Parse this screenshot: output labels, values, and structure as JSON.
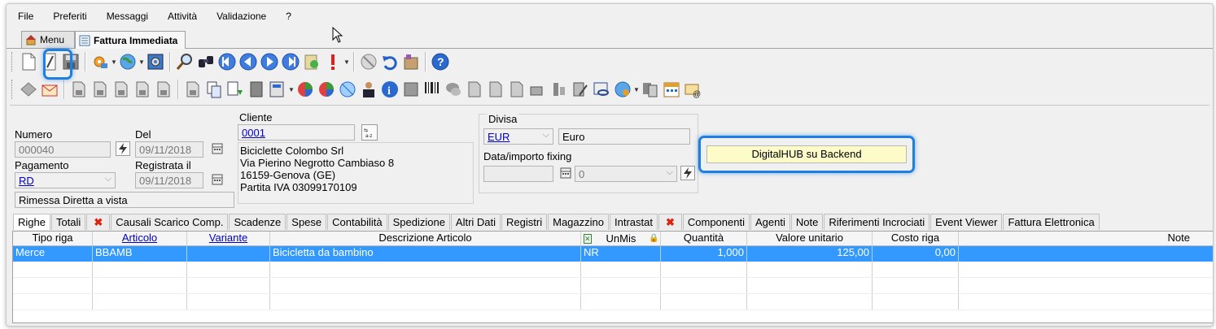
{
  "menu": [
    "File",
    "Preferiti",
    "Messaggi",
    "Attività",
    "Validazione",
    "?"
  ],
  "doc_tabs": [
    {
      "label": "Menu",
      "active": false
    },
    {
      "label": "Fattura Immediata",
      "active": true
    }
  ],
  "form": {
    "numero_label": "Numero",
    "numero_value": "000040",
    "del_label": "Del",
    "del_value": "09/11/2018",
    "pagamento_label": "Pagamento",
    "pagamento_value": "RD",
    "pagamento_desc": "Rimessa Diretta a vista",
    "registrata_label": "Registrata il",
    "registrata_value": "09/11/2018",
    "cliente_label": "Cliente",
    "cliente_code": "0001",
    "cliente_address": [
      "Biciclette Colombo Srl",
      "Via Pierino Negrotto Cambiaso 8",
      "16159-Genova (GE)",
      "Partita IVA 03099170109"
    ],
    "divisa_label": "Divisa",
    "divisa_code": "EUR",
    "divisa_name": "Euro",
    "fixing_label": "Data/importo fixing",
    "fixing_value": "0",
    "digitalhub": "DigitalHUB su Backend"
  },
  "sub_tabs": [
    "Righe",
    "Totali",
    "x",
    "Causali Scarico Comp.",
    "Scadenze",
    "Spese",
    "Contabilità",
    "Spedizione",
    "Altri Dati",
    "Registri",
    "Magazzino",
    "Intrastat",
    "x",
    "Componenti",
    "Agenti",
    "Note",
    "Riferimenti Incrociati",
    "Event Viewer",
    "Fattura Elettronica"
  ],
  "grid": {
    "columns": [
      "Tipo riga",
      "Articolo",
      "Variante",
      "Descrizione Articolo",
      "UnMis",
      "Quantità",
      "Valore unitario",
      "Costo riga",
      "Note"
    ],
    "rows": [
      {
        "tipo": "Merce",
        "articolo": "BBAMB",
        "variante": "",
        "descrizione": "Bicicletta da bambino",
        "unmis": "NR",
        "quantita": "1,000",
        "valore": "125,00",
        "costo": "0,00",
        "note": ""
      }
    ]
  },
  "colors": {
    "accent": "#1e7fe0",
    "selection": "#3399ff",
    "highlight_field": "#fdfbc8"
  }
}
